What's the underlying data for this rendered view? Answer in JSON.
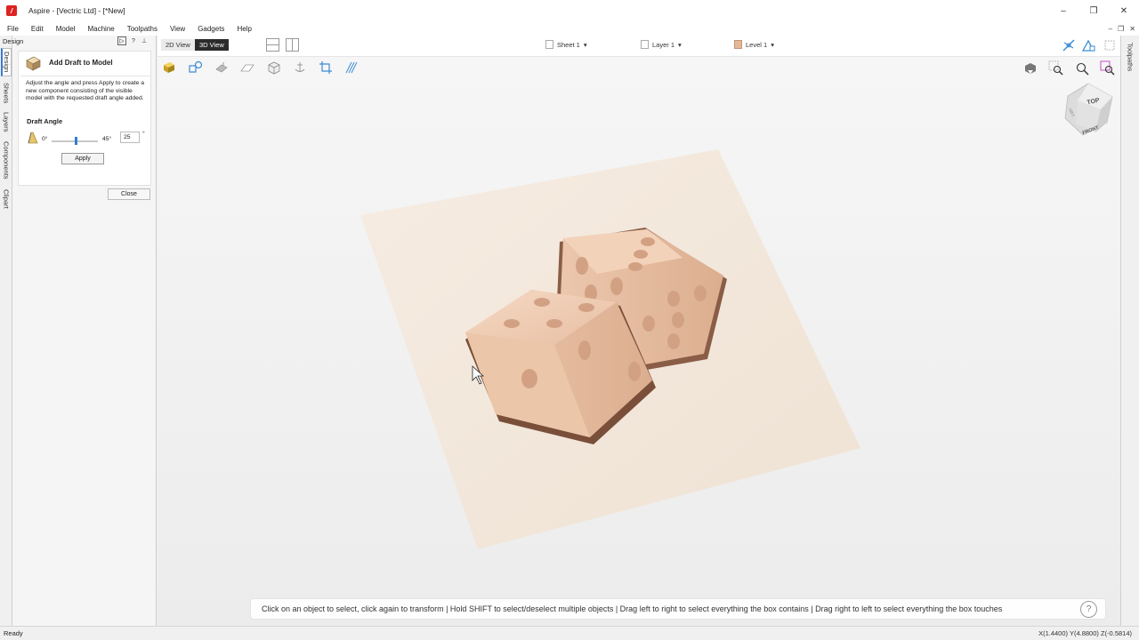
{
  "window": {
    "title": "Aspire - [Vectric Ltd] - [*New]",
    "app_icon_glyph": "/",
    "controls": [
      "–",
      "❐",
      "✕"
    ]
  },
  "menu": {
    "items": [
      "File",
      "Edit",
      "Model",
      "Machine",
      "Toolpaths",
      "View",
      "Gadgets",
      "Help"
    ],
    "mdi_controls": [
      "–",
      "❐",
      "✕"
    ]
  },
  "left_tabs": [
    "Design",
    "Sheets",
    "Layers",
    "Components",
    "Clipart"
  ],
  "right_tabs": [
    "Toolpaths"
  ],
  "panel": {
    "header_label": "Design",
    "tool_title": "Add Draft to Model",
    "description": "Adjust the angle and press Apply to create a new component consisting of the visible model with the requested draft angle added.",
    "draft_angle_label": "Draft Angle",
    "slider_min_label": "0°",
    "slider_max_label": "45°",
    "slider_value": 25,
    "angle_value": "25",
    "angle_unit": "°",
    "apply_label": "Apply",
    "close_label": "Close"
  },
  "view_toolbar": {
    "view_2d_label": "2D View",
    "view_3d_label": "3D View",
    "active_view": "3D View",
    "sheet_label": "Sheet 1",
    "layer_label": "Layer 1",
    "level_label": "Level 1",
    "dropdown_arrow": "▾"
  },
  "viewport": {
    "toolbar_icons": [
      "gold-material-icon",
      "shapes-icon",
      "lighting-icon",
      "plane-icon",
      "wireframe-box-icon",
      "anchor-icon",
      "crop-icon",
      "hatch-icon"
    ],
    "right_icons": [
      "view-dropdown-icon",
      "zoom-box-icon",
      "zoom-icon",
      "zoom-selected-icon"
    ],
    "view_cube_labels": {
      "top": "TOP",
      "front": "FRONT",
      "left": "LEFT"
    },
    "hint_text": "Click on an object to select, click again to transform | Hold SHIFT to select/deselect multiple objects | Drag left to right to select everything the box contains | Drag right to left to select everything the box touches",
    "help_glyph": "?"
  },
  "status": {
    "text": "Ready",
    "coordinates": "X(1.4400) Y(4.8800) Z(-0.5814)"
  },
  "colors": {
    "accent": "#2f7fd4",
    "wood": "#e7c2a8",
    "board": "#f3e6da"
  }
}
